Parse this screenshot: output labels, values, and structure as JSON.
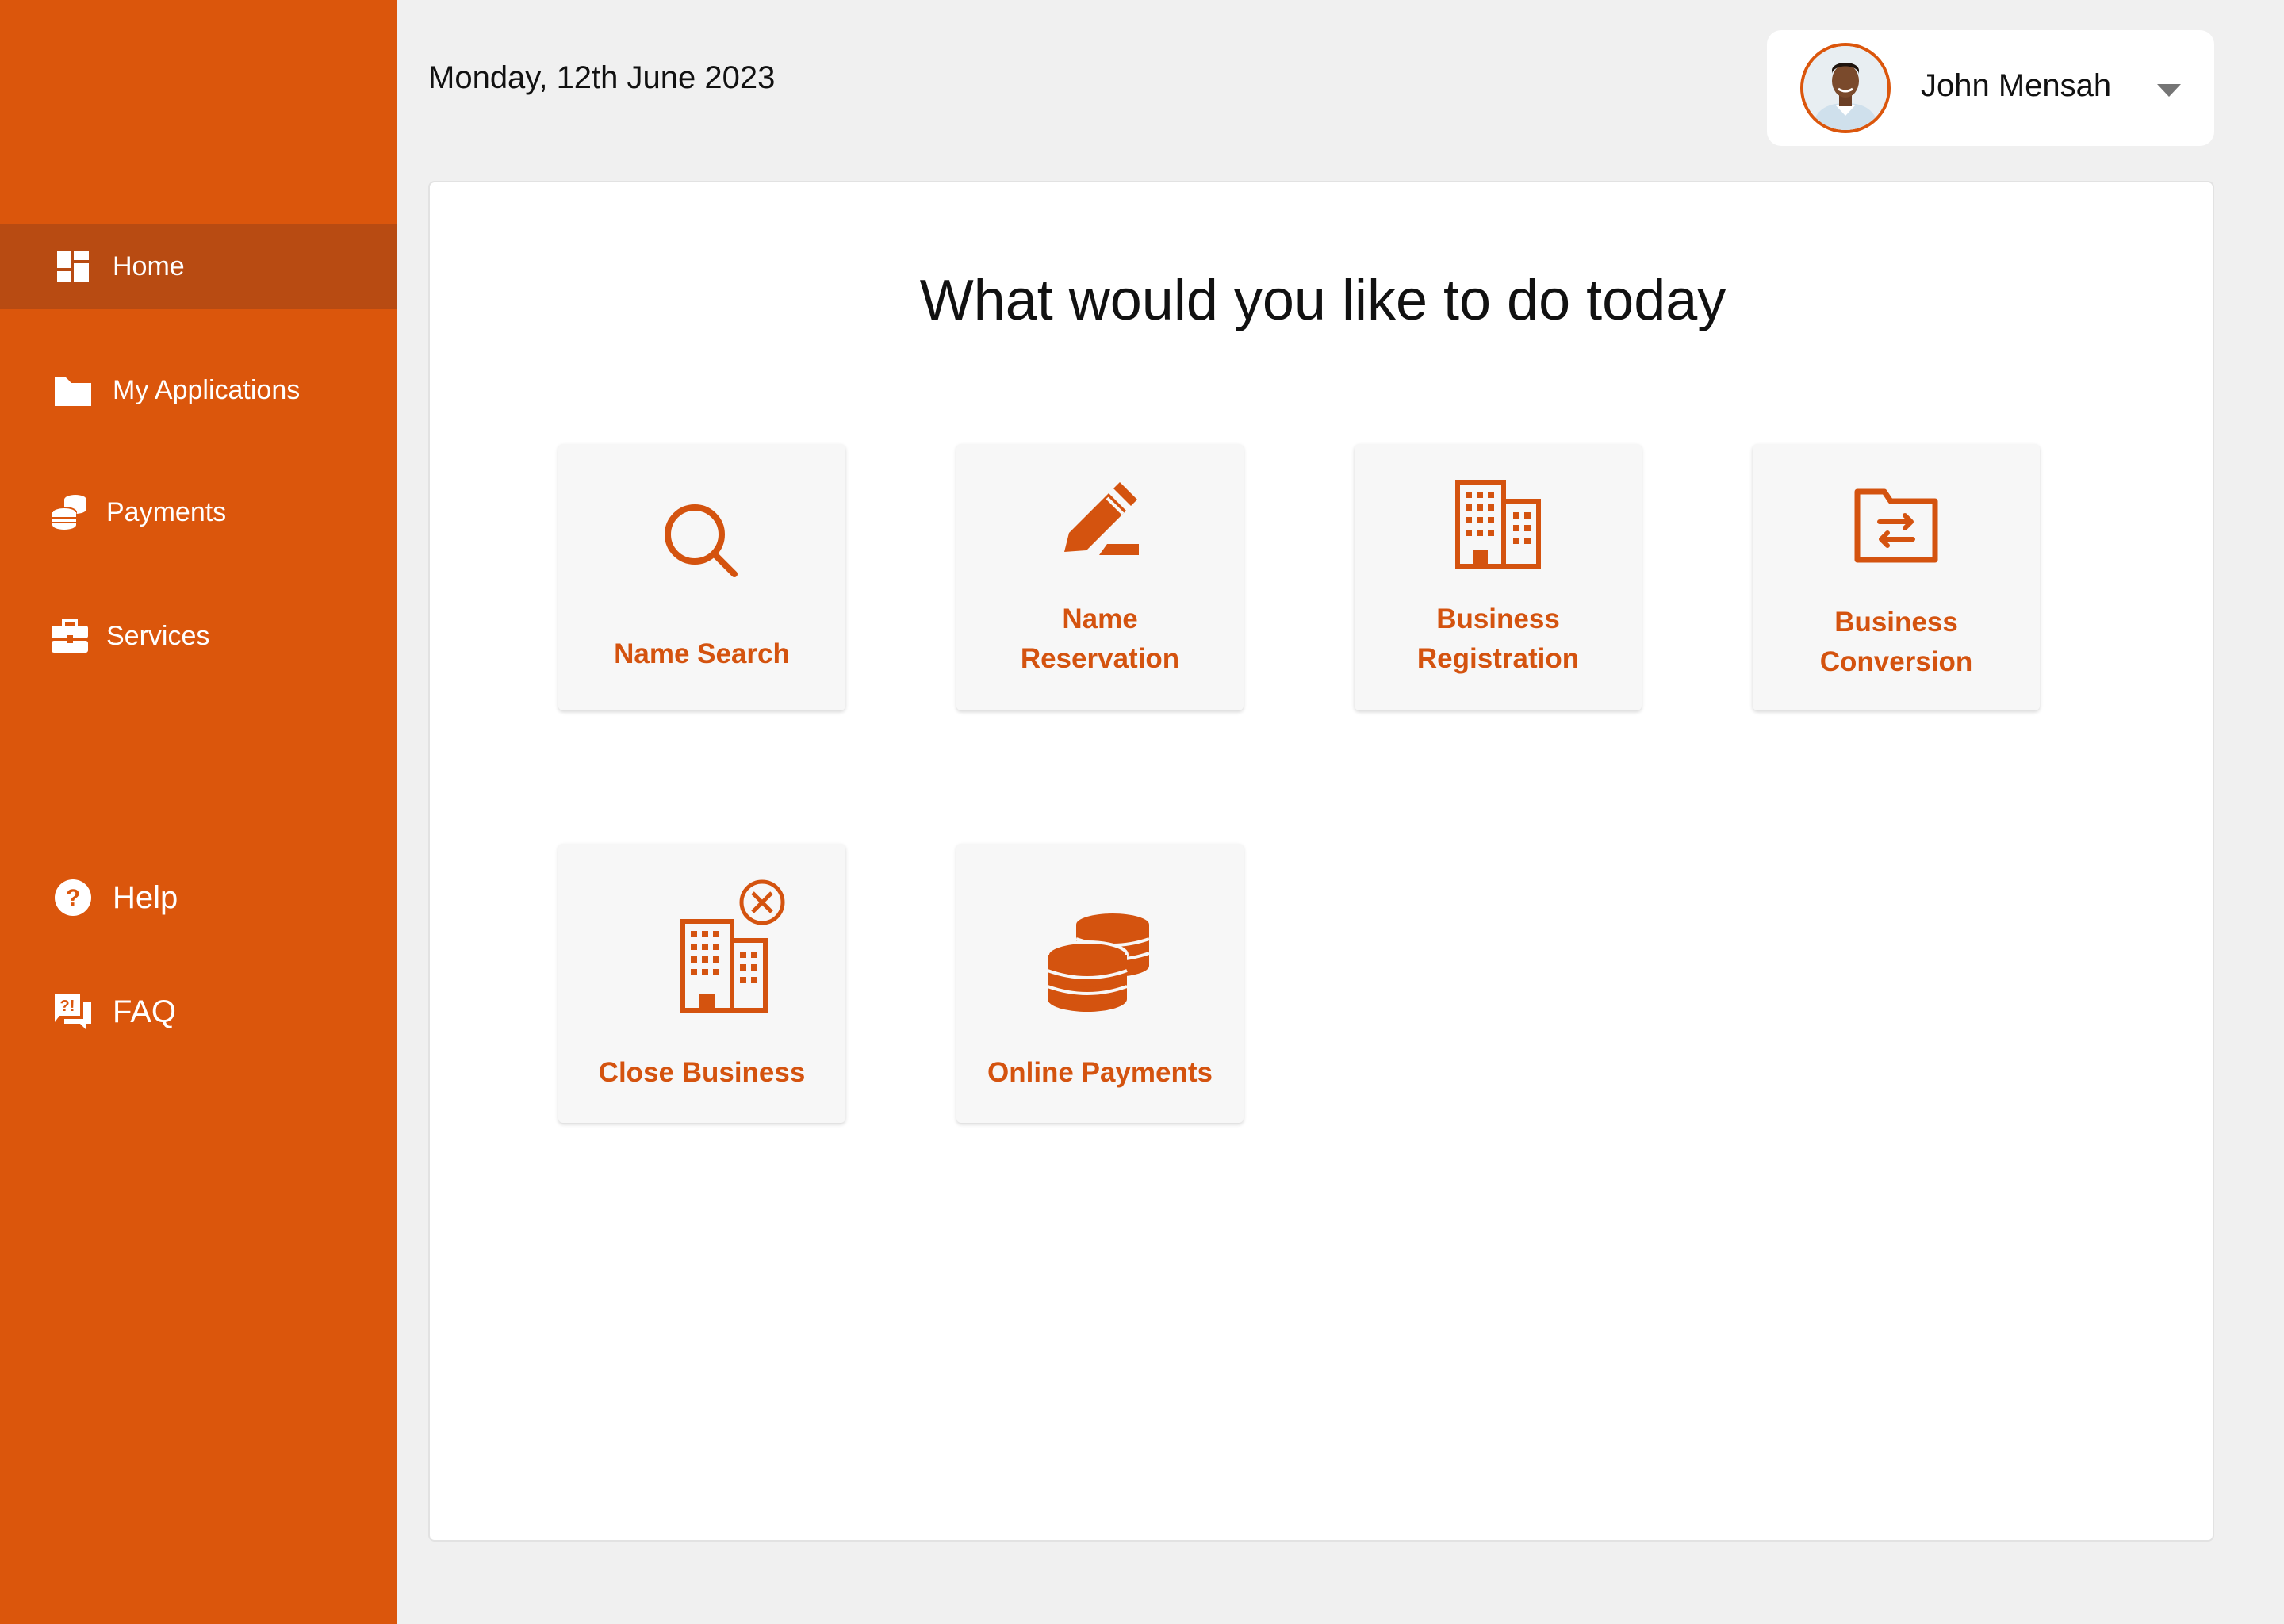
{
  "sidebar": {
    "items": [
      {
        "label": "Home",
        "icon": "dashboard-icon",
        "active": true
      },
      {
        "label": "My Applications",
        "icon": "folder-icon"
      },
      {
        "label": "Payments",
        "icon": "coins-icon"
      },
      {
        "label": "Services",
        "icon": "briefcase-icon"
      }
    ],
    "bottom_items": [
      {
        "label": "Help",
        "icon": "help-icon"
      },
      {
        "label": "FAQ",
        "icon": "faq-icon"
      }
    ]
  },
  "header": {
    "date": "Monday, 12th June 2023",
    "user": {
      "name": "John Mensah",
      "avatar": "user-avatar"
    }
  },
  "main": {
    "title": "What would you like to do today",
    "tiles": [
      {
        "label_lines": [
          "Name Search"
        ],
        "icon": "search-icon"
      },
      {
        "label_lines": [
          "Name",
          "Reservation"
        ],
        "icon": "pen-icon"
      },
      {
        "label_lines": [
          "Business",
          "Registration"
        ],
        "icon": "building-icon"
      },
      {
        "label_lines": [
          "Business",
          "Conversion"
        ],
        "icon": "folder-exchange-icon"
      },
      {
        "label_lines": [
          "Close Business"
        ],
        "icon": "building-close-icon"
      },
      {
        "label_lines": [
          "Online Payments"
        ],
        "icon": "coins-stack-icon"
      }
    ]
  },
  "colors": {
    "brand": "#db560c",
    "sidebar_active": "#b84b12",
    "tile_text": "#d4530f",
    "background": "#f0f0f0"
  }
}
